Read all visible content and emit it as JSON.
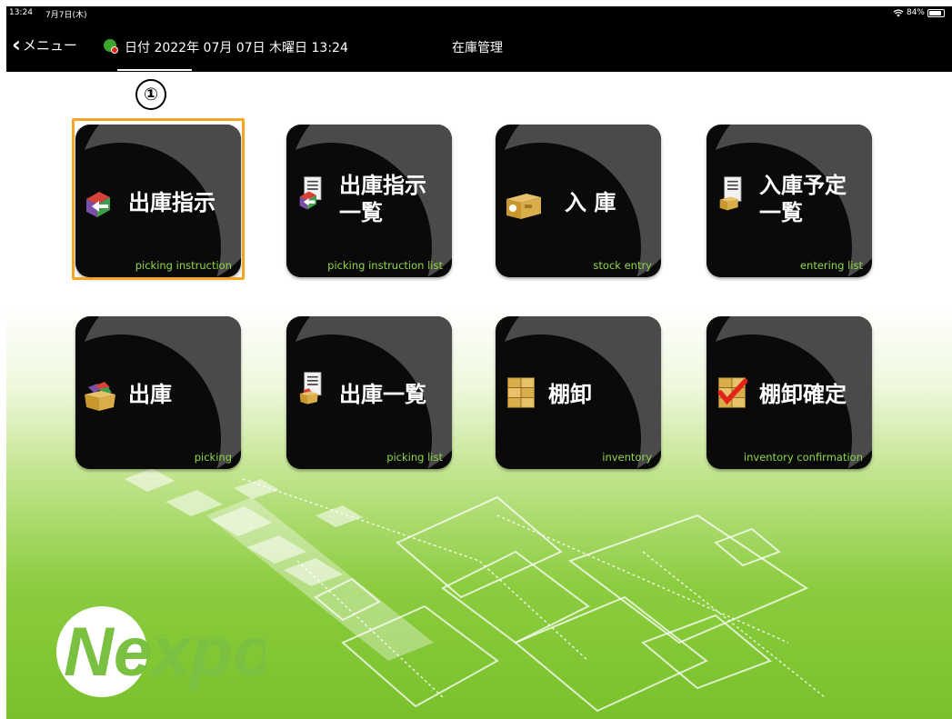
{
  "status_bar": {
    "time": "13:24",
    "date": "7月7日(木)",
    "battery_percent": "84%"
  },
  "nav": {
    "back_label": "メニュー",
    "date_prefix": "日付",
    "date_value": "2022年 07月 07日 木曜日 13:24",
    "title": "在庫管理"
  },
  "annotation": {
    "marker": "①"
  },
  "tiles": [
    {
      "title_line1": "出庫指示",
      "title_line2": "",
      "subtitle": "picking instruction",
      "icon": "picking-instruction-icon"
    },
    {
      "title_line1": "出庫指示",
      "title_line2": "一覧",
      "subtitle": "picking instruction list",
      "icon": "picking-instruction-list-icon"
    },
    {
      "title_line1": "入 庫",
      "title_line2": "",
      "subtitle": "stock entry",
      "icon": "stock-entry-icon"
    },
    {
      "title_line1": "入庫予定",
      "title_line2": "一覧",
      "subtitle": "entering list",
      "icon": "entering-list-icon"
    },
    {
      "title_line1": "出庫",
      "title_line2": "",
      "subtitle": "picking",
      "icon": "picking-icon"
    },
    {
      "title_line1": "出庫一覧",
      "title_line2": "",
      "subtitle": "picking list",
      "icon": "picking-list-icon"
    },
    {
      "title_line1": "棚卸",
      "title_line2": "",
      "subtitle": "inventory",
      "icon": "inventory-icon"
    },
    {
      "title_line1": "棚卸確定",
      "title_line2": "",
      "subtitle": "inventory confirmation",
      "icon": "inventory-confirmation-icon"
    }
  ],
  "logo": {
    "text": "Nexpo"
  },
  "colors": {
    "accent_green": "#8fd64b",
    "highlight": "#f5a623",
    "brand_green": "#7ac142"
  }
}
